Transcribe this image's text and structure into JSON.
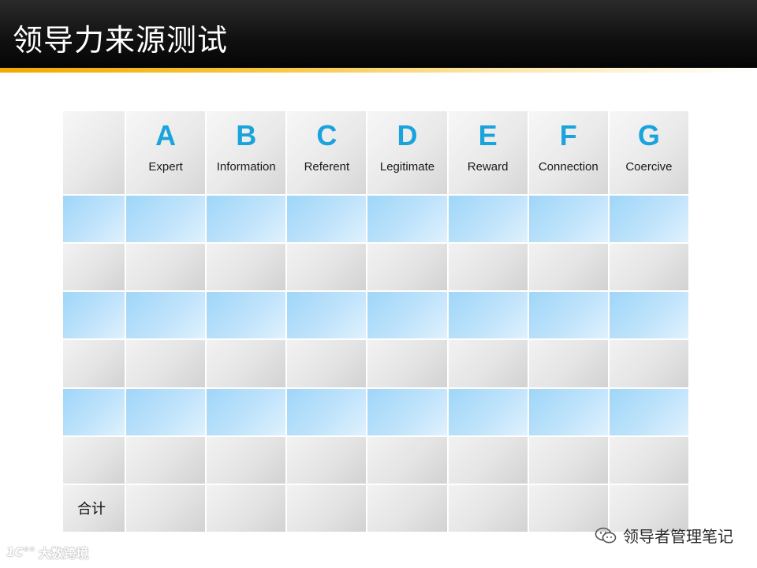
{
  "slide": {
    "title": "领导力来源测试"
  },
  "table": {
    "columns": [
      {
        "letter": "A",
        "label": "Expert"
      },
      {
        "letter": "B",
        "label": "Information"
      },
      {
        "letter": "C",
        "label": "Referent"
      },
      {
        "letter": "D",
        "label": "Legitimate"
      },
      {
        "letter": "E",
        "label": "Reward"
      },
      {
        "letter": "F",
        "label": "Connection"
      },
      {
        "letter": "G",
        "label": "Coercive"
      }
    ],
    "total_label": "合计"
  },
  "watermark": {
    "right_text": "领导者管理笔记",
    "left_logo": "1C°°",
    "left_text": "大数跨境"
  },
  "colors": {
    "header_bar": "#111111",
    "accent": "#f2a900",
    "letter": "#1aa3dc",
    "blue_row": "#bfe3fb",
    "gray_row": "#e4e4e4"
  }
}
